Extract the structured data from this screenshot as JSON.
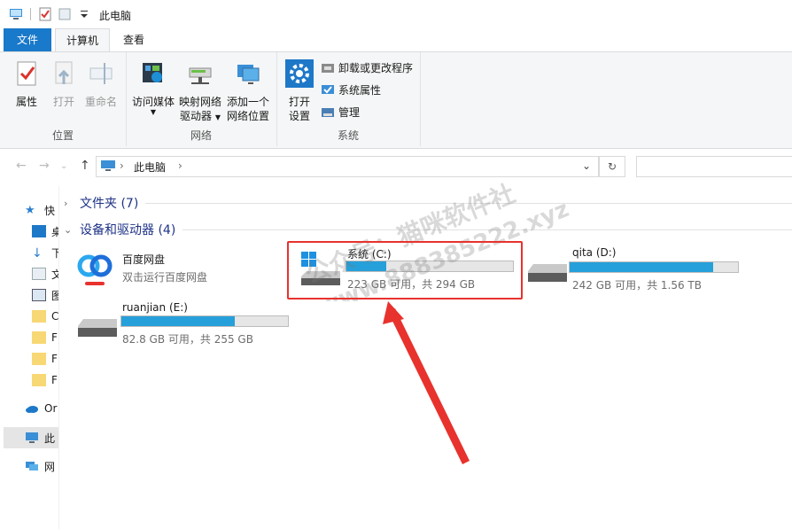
{
  "window": {
    "title": "此电脑"
  },
  "tabs": [
    {
      "label": "文件"
    },
    {
      "label": "计算机"
    },
    {
      "label": "查看"
    }
  ],
  "ribbon": {
    "groups": [
      {
        "label": "位置",
        "buttons": [
          "属性",
          "打开",
          "重命名"
        ]
      },
      {
        "label": "网络",
        "buttons": [
          "访问媒体",
          "映射网络",
          "驱动器",
          "添加一个",
          "网络位置"
        ]
      },
      {
        "label": "系统",
        "buttons": [
          "打开",
          "设置"
        ],
        "small": [
          "卸载或更改程序",
          "系统属性",
          "管理"
        ]
      }
    ]
  },
  "address": {
    "path": "此电脑"
  },
  "nav": {
    "items": [
      "快",
      "桌",
      "下",
      "文",
      "图",
      "C",
      "F",
      "F",
      "F",
      "Or",
      "此",
      "网"
    ]
  },
  "sections": [
    {
      "title": "文件夹 (7)"
    },
    {
      "title": "设备和驱动器 (4)"
    }
  ],
  "drives": [
    {
      "name": "百度网盘",
      "info": "双击运行百度网盘"
    },
    {
      "name": "系统 (C:)",
      "info": "223 GB 可用，共 294 GB",
      "used": 0.24
    },
    {
      "name": "qita (D:)",
      "info": "242 GB 可用，共 1.56 TB",
      "used": 0.85
    },
    {
      "name": "ruanjian (E:)",
      "info": "82.8 GB 可用，共 255 GB",
      "used": 0.68
    }
  ],
  "watermark": {
    "line1": "公众号：猫咪软件社",
    "line2": "www.888385222.xyz"
  },
  "colors": {
    "accent": "#1979ca",
    "progress": "#26a0da",
    "highlight": "#e8322d"
  }
}
